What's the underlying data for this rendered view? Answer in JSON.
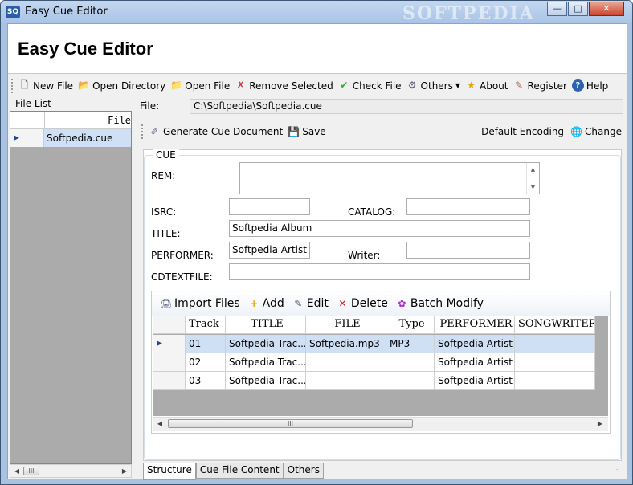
{
  "window": {
    "title": "Easy Cue Editor",
    "icon_text": "SQ",
    "watermark": "SOFTPEDIA",
    "controls": {
      "minimize": "—",
      "maximize": "□",
      "close": "✕"
    }
  },
  "header": {
    "title": "Easy Cue Editor"
  },
  "toolbar": {
    "items": [
      {
        "label": "New File",
        "icon": "new-file-icon"
      },
      {
        "label": "Open Directory",
        "icon": "folder-open-icon"
      },
      {
        "label": "Open File",
        "icon": "open-file-icon"
      },
      {
        "label": "Remove Selected",
        "icon": "remove-icon"
      },
      {
        "label": "Check File",
        "icon": "check-icon"
      },
      {
        "label": "Others",
        "icon": "others-icon"
      },
      {
        "label": "About",
        "icon": "about-icon"
      },
      {
        "label": "Register",
        "icon": "register-icon"
      },
      {
        "label": "Help",
        "icon": "help-icon"
      }
    ]
  },
  "file_list": {
    "label": "File List",
    "column": "File",
    "rows": [
      "Softpedia.cue"
    ],
    "scroll_thumb": "III"
  },
  "file_path": {
    "label": "File:",
    "value": "C:\\Softpedia\\Softpedia.cue"
  },
  "toolbar2": {
    "generate": "Generate Cue Document",
    "save": "Save",
    "encoding": "Default Encoding",
    "change": "Change"
  },
  "cue": {
    "legend": "CUE",
    "rem_label": "REM:",
    "rem_value": "",
    "isrc_label": "ISRC:",
    "isrc_value": "",
    "catalog_label": "CATALOG:",
    "catalog_value": "",
    "title_label": "TITLE:",
    "title_value": "Softpedia Album",
    "performer_label": "PERFORMER:",
    "performer_value": "Softpedia Artist",
    "writer_label": "Writer:",
    "writer_value": "",
    "cdtextfile_label": "CDTEXTFILE:",
    "cdtextfile_value": ""
  },
  "tracks_toolbar": {
    "import": "Import Files",
    "add": "Add",
    "edit": "Edit",
    "delete": "Delete",
    "batch": "Batch Modify"
  },
  "tracks": {
    "columns": [
      "Track",
      "TITLE",
      "FILE",
      "Type",
      "PERFORMER",
      "SONGWRITER"
    ],
    "rows": [
      {
        "track": "01",
        "title": "Softpedia Trac...",
        "file": "Softpedia.mp3",
        "type": "MP3",
        "performer": "Softpedia Artist",
        "songwriter": ""
      },
      {
        "track": "02",
        "title": "Softpedia Trac...",
        "file": "",
        "type": "",
        "performer": "Softpedia Artist",
        "songwriter": ""
      },
      {
        "track": "03",
        "title": "Softpedia Trac...",
        "file": "",
        "type": "",
        "performer": "Softpedia Artist",
        "songwriter": ""
      }
    ],
    "scroll_thumb": "III"
  },
  "tabs": [
    "Structure",
    "Cue File Content",
    "Others"
  ]
}
